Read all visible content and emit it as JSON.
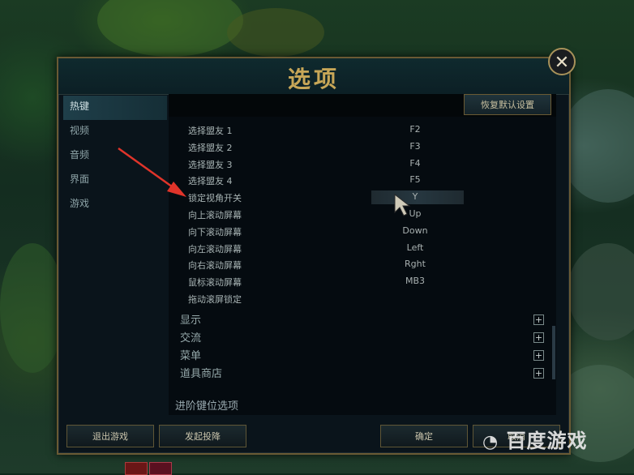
{
  "dialog": {
    "title": "选项",
    "close_label": "✕",
    "reset_button": "恢复默认设置"
  },
  "sidebar": {
    "items": [
      {
        "label": "热键",
        "active": true
      },
      {
        "label": "视频",
        "active": false
      },
      {
        "label": "音频",
        "active": false
      },
      {
        "label": "界面",
        "active": false
      },
      {
        "label": "游戏",
        "active": false
      }
    ]
  },
  "hotkeys": [
    {
      "action": "选择盟友 1",
      "key": "F2"
    },
    {
      "action": "选择盟友 2",
      "key": "F3"
    },
    {
      "action": "选择盟友 3",
      "key": "F4"
    },
    {
      "action": "选择盟友 4",
      "key": "F5"
    },
    {
      "action": "锁定视角开关",
      "key": "Y"
    },
    {
      "action": "向上滚动屏幕",
      "key": "Up"
    },
    {
      "action": "向下滚动屏幕",
      "key": "Down"
    },
    {
      "action": "向左滚动屏幕",
      "key": "Left"
    },
    {
      "action": "向右滚动屏幕",
      "key": "Rght"
    },
    {
      "action": "鼠标滚动屏幕",
      "key": "MB3"
    },
    {
      "action": "拖动滚屏锁定",
      "key": ""
    }
  ],
  "sections": [
    {
      "label": "显示",
      "icon": "+"
    },
    {
      "label": "交流",
      "icon": "+"
    },
    {
      "label": "菜单",
      "icon": "+"
    },
    {
      "label": "道具商店",
      "icon": "+"
    }
  ],
  "advanced_label": "进阶键位选项",
  "footer": {
    "exit_game": "退出游戏",
    "surrender": "发起投降",
    "ok": "确定",
    "cancel": "取消"
  },
  "watermark": "百度游戏",
  "colors": {
    "accent_gold": "#c7a657",
    "border_gold": "#6a5a34",
    "panel_bg": "#050b10",
    "annotation_red": "#e0342a"
  }
}
